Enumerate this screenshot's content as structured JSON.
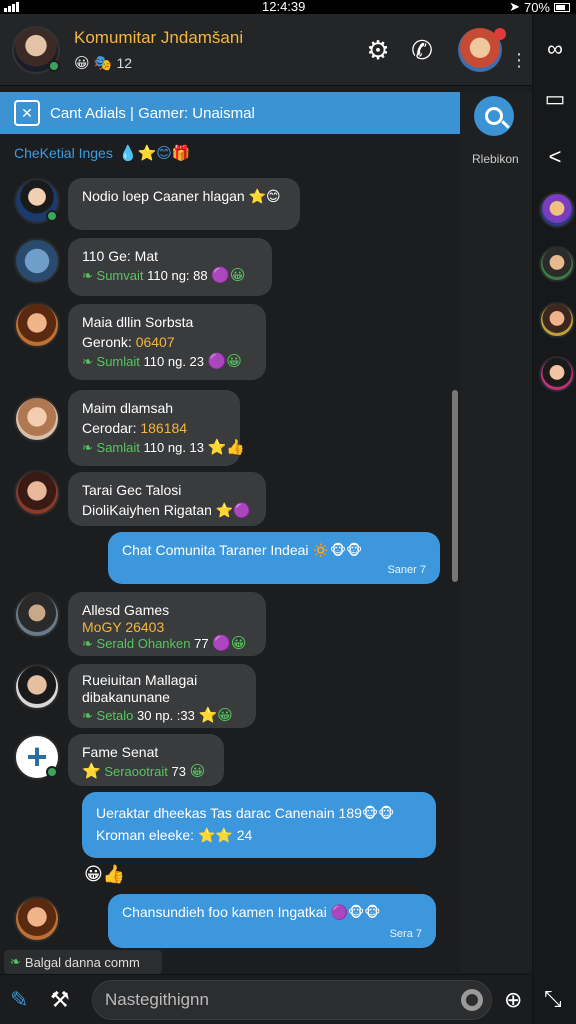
{
  "status": {
    "time": "12:4:39",
    "battery": "70%"
  },
  "header": {
    "title": "Komumitar Jndamšani",
    "subtitle_count": "12",
    "subtitle_icons": "😀 🎭"
  },
  "banner": {
    "text": "Cant Adials | Gamer: Unaismal"
  },
  "tags": {
    "label": "CheKetial Inges",
    "icons": "💧⭐😊🎁"
  },
  "search": {
    "label": "Rlebikon"
  },
  "messages": [
    {
      "lines": [
        "Nodio loep Caaner hlagan ⭐😊"
      ]
    },
    {
      "lines": [
        "110 Ge: Mat"
      ],
      "meta": "Sumvait",
      "meta_num": "110 ng: 88",
      "emoji": "🟣😀"
    },
    {
      "lines": [
        "Maia dllin Sorbsta"
      ],
      "hl_prefix": "Geronk: ",
      "hl": "06407",
      "meta": "Sumlait",
      "meta_num": "110 ng. 23",
      "emoji": "🟣😀"
    },
    {
      "lines": [
        "Maim dlamsah"
      ],
      "hl_prefix": "Cerodar: ",
      "hl": "186184",
      "meta": "Samlait",
      "meta_num": "110 ng. 13",
      "emoji": "⭐👍"
    },
    {
      "lines": [
        "Tarai Gec Talosi",
        "DioliKaiyhen Rigatan ⭐🟣"
      ]
    },
    {
      "lines": [
        "Chat Comunita Taraner Indeai 🔅🐵🐵"
      ],
      "sent": "Saner 7"
    },
    {
      "lines": [
        "Allesd Games"
      ],
      "hl": "MoGY 26403",
      "meta": "Serald Ohanken",
      "meta_num": "77",
      "emoji": "🟣😀"
    },
    {
      "lines": [
        "Rueiuitan Mallagai",
        "dibakanunane"
      ],
      "meta": "Setalo",
      "meta_num": "30 np. :33",
      "emoji": "⭐😀"
    },
    {
      "lines": [
        "Fame Senat"
      ],
      "meta": "Seraootrait",
      "meta_num": "73",
      "emoji": "😀"
    },
    {
      "lines": [
        "Ueraktar dheekas Tas darac Canenain 189🐵🐵",
        "Kroman eleeke: ⭐⭐ 24"
      ]
    },
    {
      "lines": [
        "Chansundieh foo kamen Ingatkai 🟣🐵🐵"
      ],
      "sent": "Sera 7"
    }
  ],
  "reactions": "😀👍",
  "pill": {
    "text": "Balgal danna comm"
  },
  "composer": {
    "placeholder": "Nastegithignn"
  }
}
